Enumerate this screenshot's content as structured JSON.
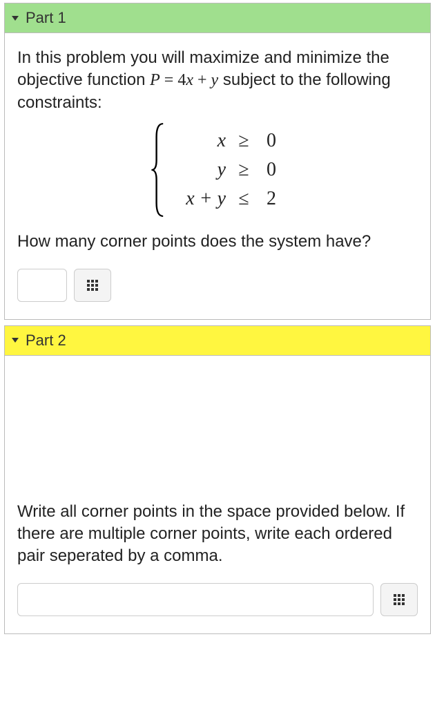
{
  "part1": {
    "header": "Part 1",
    "intro_1": "In this problem you will maximize and minimize the objective function ",
    "objective_P": "P",
    "objective_eq": " = ",
    "objective_rhs_coef": "4",
    "objective_rhs_x": "x",
    "objective_plus": " + ",
    "objective_rhs_y": "y",
    "intro_2": " subject to the following constraints:",
    "constraints": [
      {
        "left": "x",
        "op": "≥",
        "right": "0"
      },
      {
        "left": "y",
        "op": "≥",
        "right": "0"
      },
      {
        "left": "x + y",
        "op": "≤",
        "right": "2"
      }
    ],
    "question": "How many corner points does the system have?",
    "input_value": ""
  },
  "part2": {
    "header": "Part 2",
    "prompt": "Write all corner points in the space provided below. If there are multiple corner points, write each ordered pair seperated by a comma.",
    "input_value": ""
  }
}
